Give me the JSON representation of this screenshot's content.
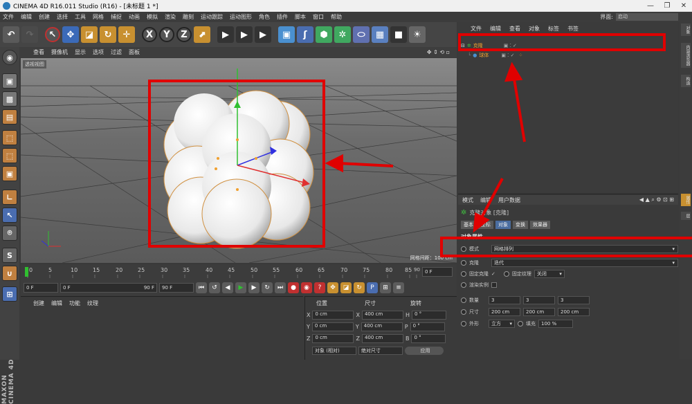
{
  "window": {
    "title": "CINEMA 4D R16.011 Studio (R16) - [未标题 1 *]",
    "minimize": "—",
    "maximize": "❐",
    "close": "✕"
  },
  "menu": {
    "items": [
      "文件",
      "编辑",
      "创建",
      "选择",
      "工具",
      "网格",
      "捕捉",
      "动画",
      "模拟",
      "渲染",
      "雕刻",
      "运动跟踪",
      "运动图形",
      "角色",
      "插件",
      "脚本",
      "窗口",
      "帮助"
    ]
  },
  "layout": {
    "label": "界面:",
    "value": "启动"
  },
  "viewport": {
    "menu": [
      "查看",
      "摄像机",
      "显示",
      "选项",
      "过滤",
      "面板"
    ],
    "label": "透视视图",
    "grid_label": "网格间距：100 cm"
  },
  "timeline": {
    "ticks": [
      "0",
      "5",
      "10",
      "15",
      "20",
      "25",
      "30",
      "35",
      "40",
      "45",
      "50",
      "55",
      "60",
      "65",
      "70",
      "75",
      "80",
      "85",
      "90"
    ],
    "end_field": "0 F"
  },
  "transport": {
    "start": "0 F",
    "range_start": "0 F",
    "range_end": "90 F",
    "end": "90 F"
  },
  "material": {
    "menu": [
      "创建",
      "编辑",
      "功能",
      "纹理"
    ]
  },
  "coords": {
    "headers": {
      "pos": "位置",
      "size": "尺寸",
      "rot": "旋转"
    },
    "rows": [
      {
        "axis": "X",
        "pos": "0 cm",
        "saxis": "X",
        "size": "400 cm",
        "raxis": "H",
        "rot": "0 °"
      },
      {
        "axis": "Y",
        "pos": "0 cm",
        "saxis": "Y",
        "size": "400 cm",
        "raxis": "P",
        "rot": "0 °"
      },
      {
        "axis": "Z",
        "pos": "0 cm",
        "saxis": "Z",
        "size": "400 cm",
        "raxis": "B",
        "rot": "0 °"
      }
    ],
    "mode": "对象 (相对)",
    "size_mode": "绝对尺寸",
    "apply": "应用"
  },
  "objects": {
    "menu": [
      "文件",
      "编辑",
      "查看",
      "对象",
      "标签",
      "书签"
    ],
    "items": [
      {
        "name": "克隆"
      },
      {
        "name": "球体"
      }
    ]
  },
  "side_tabs": [
    "对象",
    "内容浏览器",
    "构造",
    "属性",
    "层"
  ],
  "attributes": {
    "top_menu": [
      "模式",
      "编辑",
      "用户数据"
    ],
    "object_title": "克隆对象 [克隆]",
    "tabs": [
      "基本",
      "坐标",
      "对象",
      "变换",
      "效果器"
    ],
    "active_tab": "对象",
    "section": "对象属性",
    "mode_label": "模式",
    "mode_value": "网格排列",
    "clone_label": "克隆",
    "clone_value": "迭代",
    "fix_clone": "固定克隆",
    "fix_clone_check": "✓",
    "fix_texture": "固定纹理",
    "fix_texture_value": "关闭",
    "render_instance": "渲染实例",
    "count_label": "数量",
    "count": [
      "3",
      "3",
      "3"
    ],
    "size_label": "尺寸",
    "size": [
      "200 cm",
      "200 cm",
      "200 cm"
    ],
    "shape_label": "外形",
    "shape_value": "立方",
    "fill_label": "填充",
    "fill_value": "100 %"
  },
  "colors": {
    "highlight": "#e00000",
    "accent": "#f0a030",
    "active_tab": "#4a6da0"
  }
}
